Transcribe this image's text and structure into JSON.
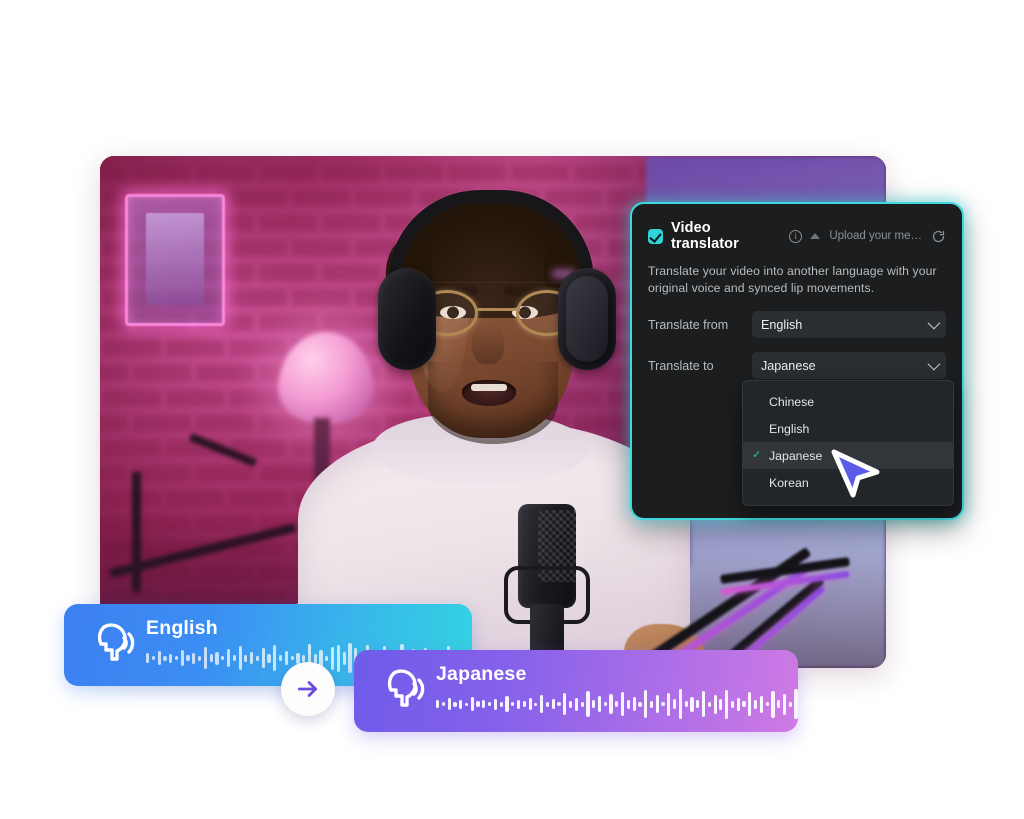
{
  "panel": {
    "checkbox_checked": true,
    "title": "Video translator",
    "info_icon": "info-circle-icon",
    "upload_label": "Upload your me…",
    "upload_icon": "upload-triangle-icon",
    "reset_icon": "reset-icon",
    "description": "Translate your video into another language with your original voice and synced lip movements.",
    "accent_border": "#3fd9dd",
    "checkbox_color": "#2fd4d8",
    "background": "#1b1d1f",
    "fields": [
      {
        "label": "Translate from",
        "value": "English"
      },
      {
        "label": "Translate to",
        "value": "Japanese"
      }
    ],
    "dropdown": {
      "selected": "Japanese",
      "check_color": "#2fc9a0",
      "options": [
        {
          "label": "Chinese",
          "selected": false
        },
        {
          "label": "English",
          "selected": false
        },
        {
          "label": "Japanese",
          "selected": true
        },
        {
          "label": "Korean",
          "selected": false
        }
      ]
    }
  },
  "cursor": {
    "icon": "mouse-pointer-icon",
    "fill": "#5b5bea"
  },
  "audio_cards": [
    {
      "language": "English",
      "icon": "speaking-head-icon",
      "gradient_from": "#3d7ff2",
      "gradient_to": "#33d3e2",
      "waveform": [
        10,
        4,
        14,
        5,
        9,
        4,
        16,
        6,
        11,
        5,
        22,
        8,
        13,
        4,
        18,
        6,
        24,
        7,
        12,
        5,
        20,
        9,
        26,
        6,
        14,
        4,
        11,
        7,
        28,
        9,
        17,
        5,
        23,
        27,
        13,
        30,
        20,
        9,
        26,
        16,
        7,
        24,
        12,
        5,
        28,
        8,
        18,
        6,
        21,
        4,
        9,
        14,
        25,
        6,
        11,
        3,
        16,
        8,
        22,
        5,
        13,
        9,
        27,
        7,
        30,
        12,
        6,
        19,
        4,
        10
      ]
    },
    {
      "language": "Japanese",
      "icon": "speaking-head-icon",
      "gradient_from": "#6f5bea",
      "gradient_to": "#cf7ae4",
      "waveform": [
        8,
        4,
        12,
        5,
        9,
        3,
        14,
        6,
        8,
        4,
        11,
        5,
        16,
        4,
        9,
        6,
        12,
        3,
        18,
        5,
        10,
        4,
        22,
        7,
        13,
        5,
        26,
        8,
        16,
        4,
        20,
        6,
        24,
        9,
        14,
        5,
        28,
        7,
        18,
        4,
        23,
        10,
        30,
        6,
        15,
        8,
        26,
        5,
        19,
        11,
        29,
        7,
        13,
        6,
        24,
        9,
        17,
        4,
        27,
        8,
        21,
        5,
        30,
        10,
        14,
        7,
        25,
        6,
        18,
        9,
        12,
        4,
        22,
        7,
        16,
        5,
        28,
        8,
        11,
        6
      ]
    }
  ],
  "swap_button": {
    "icon": "arrow-right-icon",
    "arrow_color": "#6d4ae0"
  },
  "video": {
    "scene_description": "Podcast studio with magenta neon brick wall and person wearing headphones speaking into a microphone"
  }
}
